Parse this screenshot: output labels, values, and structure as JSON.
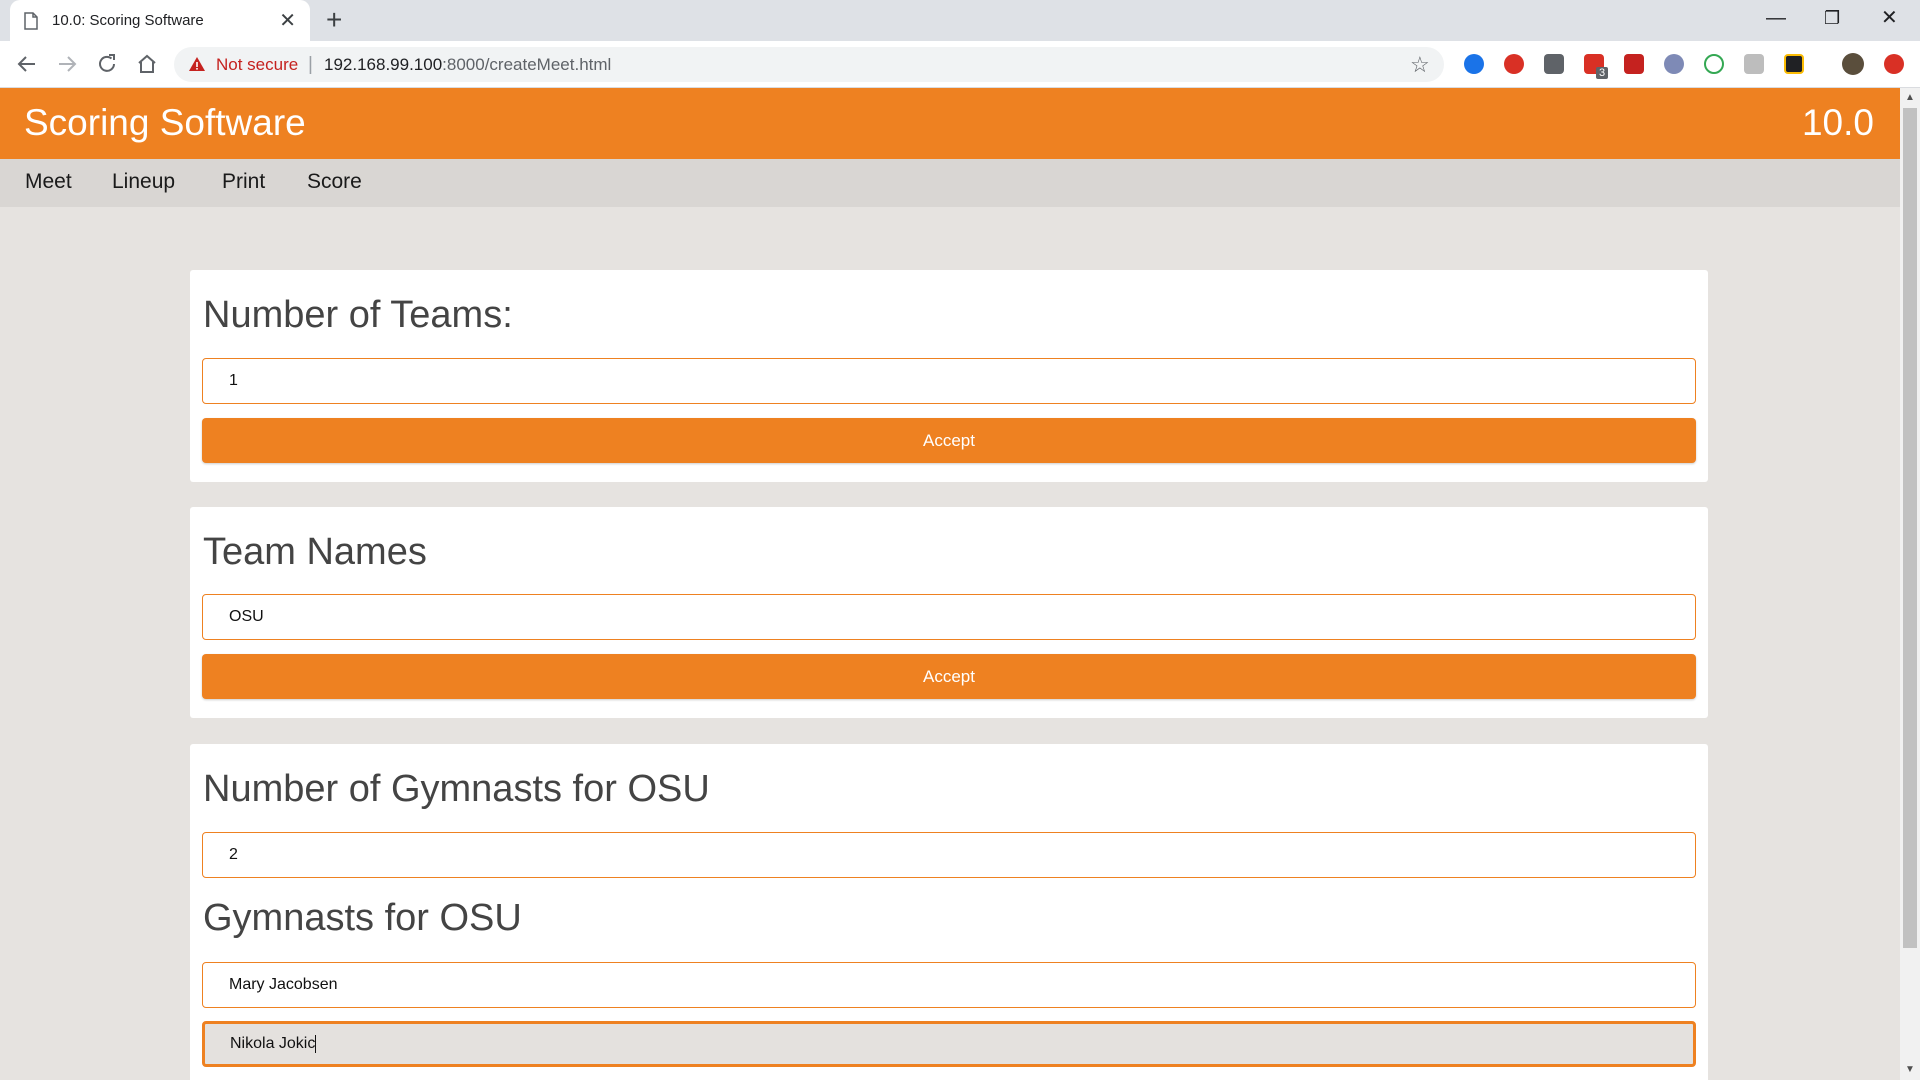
{
  "browser": {
    "tab_title": "10.0: Scoring Software",
    "new_tab": "+",
    "security_label": "Not secure",
    "url_host": "192.168.99.100",
    "url_rest": ":8000/createMeet.html",
    "ext_badge": "3"
  },
  "app": {
    "title": "Scoring Software",
    "version": "10.0",
    "nav": [
      "Meet",
      "Lineup",
      "Print",
      "Score"
    ]
  },
  "teams_card": {
    "heading": "Number of Teams:",
    "value": "1",
    "button": "Accept"
  },
  "names_card": {
    "heading": "Team Names",
    "value": "OSU",
    "button": "Accept"
  },
  "gymnasts_card": {
    "count_heading": "Number of Gymnasts for OSU",
    "count_value": "2",
    "list_heading": "Gymnasts for OSU",
    "gymnasts": [
      "Mary Jacobsen",
      "Nikola Jokic"
    ]
  },
  "colors": {
    "accent": "#ee8121",
    "page_bg": "#e6e3e0",
    "nav_bg": "#d9d6d3"
  }
}
